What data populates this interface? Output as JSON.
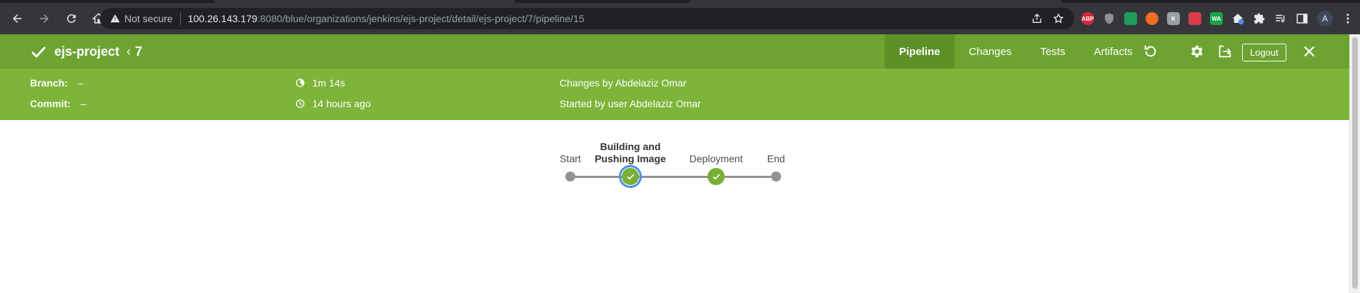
{
  "browser": {
    "security_label": "Not secure",
    "url_host": "100.26.143.179",
    "url_path": ":8080/blue/organizations/jenkins/ejs-project/detail/ejs-project/7/pipeline/15",
    "profile_initial": "A",
    "extensions": [
      {
        "name": "adblock-plus-icon",
        "label": "ABP",
        "color": "#d9263b"
      },
      {
        "name": "shield-ext-icon",
        "label": "",
        "color": "#8a8f98"
      },
      {
        "name": "green-ext-icon",
        "label": "",
        "color": "#1e9e5a"
      },
      {
        "name": "orange-ext-icon",
        "label": "",
        "color": "#f26b22"
      },
      {
        "name": "font-ext-icon",
        "label": "K",
        "color": "#9aa0a6"
      },
      {
        "name": "red-ext-icon",
        "label": "",
        "color": "#d93b4a"
      },
      {
        "name": "wa-ext-icon",
        "label": "WA",
        "color": "#1aa34a"
      }
    ]
  },
  "header": {
    "project": "ejs-project",
    "run_number": "7",
    "tabs": [
      {
        "label": "Pipeline",
        "active": true
      },
      {
        "label": "Changes",
        "active": false
      },
      {
        "label": "Tests",
        "active": false
      },
      {
        "label": "Artifacts",
        "active": false
      }
    ],
    "logout_label": "Logout",
    "bg_color": "#6ca331"
  },
  "info": {
    "branch_label": "Branch:",
    "branch_value": "–",
    "commit_label": "Commit:",
    "commit_value": "–",
    "duration": "1m 14s",
    "ago": "14 hours ago",
    "changes": "Changes by Abdelaziz Omar",
    "started": "Started by user Abdelaziz Omar",
    "bg_color": "#7db53a"
  },
  "pipeline": {
    "stages": [
      {
        "name": "Start",
        "status": "start"
      },
      {
        "name_line1": "Building and",
        "name_line2": "Pushing Image",
        "status": "success",
        "selected": true
      },
      {
        "name": "Deployment",
        "status": "success"
      },
      {
        "name": "End",
        "status": "end"
      }
    ]
  }
}
